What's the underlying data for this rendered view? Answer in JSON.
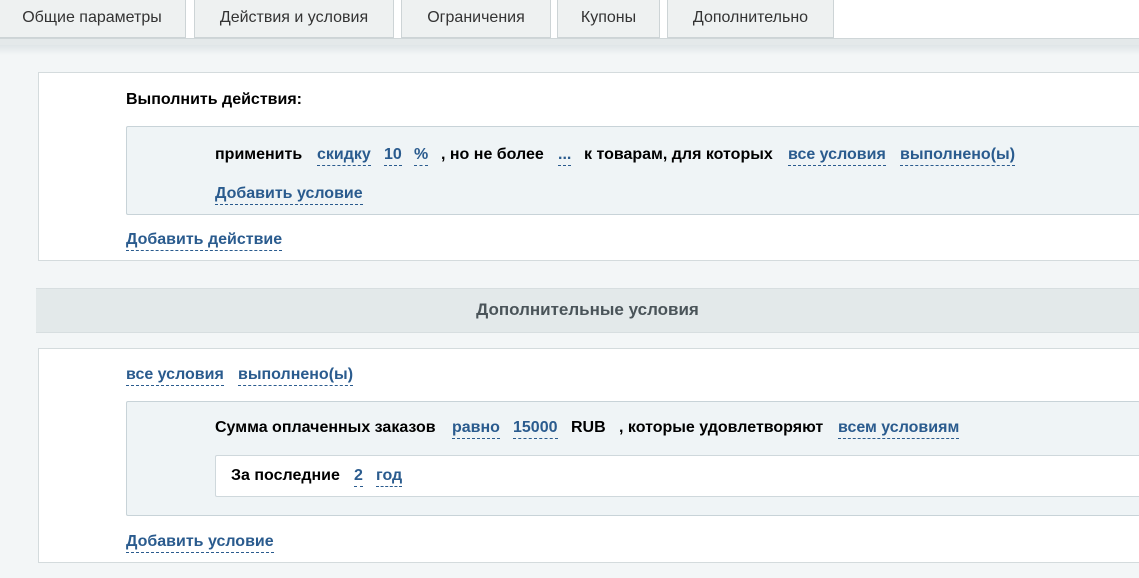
{
  "tabs": [
    {
      "label": "Общие параметры"
    },
    {
      "label": "Действия и условия"
    },
    {
      "label": "Ограничения"
    },
    {
      "label": "Купоны"
    },
    {
      "label": "Дополнительно"
    }
  ],
  "actions": {
    "title": "Выполнить действия:",
    "rule": {
      "apply": "применить",
      "type": "скидку",
      "value": "10",
      "unit": "%",
      "not_more": ", но не более",
      "max": "...",
      "for_goods": "к товарам, для которых",
      "scope": "все условия",
      "state": "выполнено(ы)"
    },
    "add_condition": "Добавить условие",
    "add_action": "Добавить действие"
  },
  "extra": {
    "header": "Дополнительные условия",
    "scope": "все условия",
    "state": "выполнено(ы)",
    "rule": {
      "label": "Сумма оплаченных заказов",
      "operator": "равно",
      "amount": "15000",
      "currency": "RUB",
      "which": ", которые удовлетворяют",
      "match": "всем условиям"
    },
    "period": {
      "label": "За последние",
      "value": "2",
      "unit": "год"
    },
    "add_condition": "Добавить условие"
  }
}
